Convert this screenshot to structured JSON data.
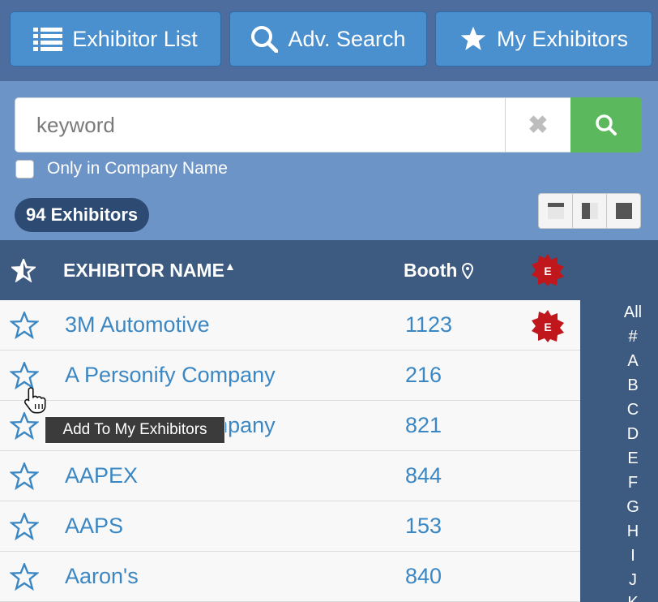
{
  "nav": {
    "exhibitor_list": "Exhibitor List",
    "adv_search": "Adv. Search",
    "my_exhibitors": "My Exhibitors"
  },
  "search": {
    "placeholder": "keyword",
    "clear_icon": "times-icon",
    "only_company_label": "Only in Company Name"
  },
  "results": {
    "count_label": "94 Exhibitors"
  },
  "table": {
    "col_name": "EXHIBITOR NAME",
    "col_booth": "Booth",
    "sort_indicator": "caret-up-icon",
    "rows": [
      {
        "name": "3M Automotive",
        "booth": "1123",
        "featured": true
      },
      {
        "name": "A Personify Company",
        "booth": "216",
        "featured": false
      },
      {
        "name": "A Personify Company",
        "booth": "821",
        "featured": false
      },
      {
        "name": "AAPEX",
        "booth": "844",
        "featured": false
      },
      {
        "name": "AAPS",
        "booth": "153",
        "featured": false
      },
      {
        "name": "Aaron's",
        "booth": "840",
        "featured": false
      }
    ]
  },
  "alphabet": [
    "All",
    "#",
    "A",
    "B",
    "C",
    "D",
    "E",
    "F",
    "G",
    "H",
    "I",
    "J",
    "K"
  ],
  "tooltip": "Add To My Exhibitors",
  "colors": {
    "nav_bg": "#4d6d9e",
    "button_blue": "#4a8fce",
    "search_bg": "#6d94c6",
    "header_bg": "#3d5a80",
    "link_blue": "#3a87c3",
    "search_green": "#5cb85c",
    "badge_red": "#c0171c"
  }
}
